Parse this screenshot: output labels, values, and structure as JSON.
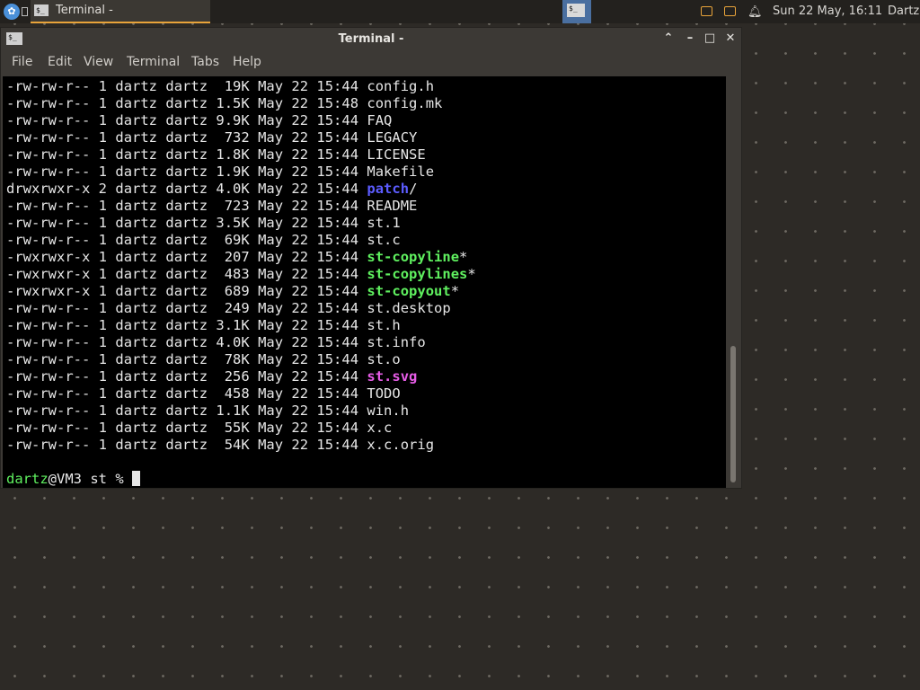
{
  "panel": {
    "task_label": "Terminal -",
    "clock": "Sun 22 May, 16:11",
    "user": "Dartz"
  },
  "window": {
    "title": "Terminal -",
    "menu": [
      "File",
      "Edit",
      "View",
      "Terminal",
      "Tabs",
      "Help"
    ]
  },
  "listing": [
    {
      "perms": "-rw-rw-r--",
      "links": "1",
      "owner": "dartz",
      "group": "dartz",
      "size": " 19K",
      "date": "May 22 15:44",
      "name": "config.h",
      "suffix": "",
      "kind": "file"
    },
    {
      "perms": "-rw-rw-r--",
      "links": "1",
      "owner": "dartz",
      "group": "dartz",
      "size": "1.5K",
      "date": "May 22 15:48",
      "name": "config.mk",
      "suffix": "",
      "kind": "file"
    },
    {
      "perms": "-rw-rw-r--",
      "links": "1",
      "owner": "dartz",
      "group": "dartz",
      "size": "9.9K",
      "date": "May 22 15:44",
      "name": "FAQ",
      "suffix": "",
      "kind": "file"
    },
    {
      "perms": "-rw-rw-r--",
      "links": "1",
      "owner": "dartz",
      "group": "dartz",
      "size": " 732",
      "date": "May 22 15:44",
      "name": "LEGACY",
      "suffix": "",
      "kind": "file"
    },
    {
      "perms": "-rw-rw-r--",
      "links": "1",
      "owner": "dartz",
      "group": "dartz",
      "size": "1.8K",
      "date": "May 22 15:44",
      "name": "LICENSE",
      "suffix": "",
      "kind": "file"
    },
    {
      "perms": "-rw-rw-r--",
      "links": "1",
      "owner": "dartz",
      "group": "dartz",
      "size": "1.9K",
      "date": "May 22 15:44",
      "name": "Makefile",
      "suffix": "",
      "kind": "file"
    },
    {
      "perms": "drwxrwxr-x",
      "links": "2",
      "owner": "dartz",
      "group": "dartz",
      "size": "4.0K",
      "date": "May 22 15:44",
      "name": "patch",
      "suffix": "/",
      "kind": "dir"
    },
    {
      "perms": "-rw-rw-r--",
      "links": "1",
      "owner": "dartz",
      "group": "dartz",
      "size": " 723",
      "date": "May 22 15:44",
      "name": "README",
      "suffix": "",
      "kind": "file"
    },
    {
      "perms": "-rw-rw-r--",
      "links": "1",
      "owner": "dartz",
      "group": "dartz",
      "size": "3.5K",
      "date": "May 22 15:44",
      "name": "st.1",
      "suffix": "",
      "kind": "file"
    },
    {
      "perms": "-rw-rw-r--",
      "links": "1",
      "owner": "dartz",
      "group": "dartz",
      "size": " 69K",
      "date": "May 22 15:44",
      "name": "st.c",
      "suffix": "",
      "kind": "file"
    },
    {
      "perms": "-rwxrwxr-x",
      "links": "1",
      "owner": "dartz",
      "group": "dartz",
      "size": " 207",
      "date": "May 22 15:44",
      "name": "st-copyline",
      "suffix": "*",
      "kind": "exe"
    },
    {
      "perms": "-rwxrwxr-x",
      "links": "1",
      "owner": "dartz",
      "group": "dartz",
      "size": " 483",
      "date": "May 22 15:44",
      "name": "st-copylines",
      "suffix": "*",
      "kind": "exe"
    },
    {
      "perms": "-rwxrwxr-x",
      "links": "1",
      "owner": "dartz",
      "group": "dartz",
      "size": " 689",
      "date": "May 22 15:44",
      "name": "st-copyout",
      "suffix": "*",
      "kind": "exe"
    },
    {
      "perms": "-rw-rw-r--",
      "links": "1",
      "owner": "dartz",
      "group": "dartz",
      "size": " 249",
      "date": "May 22 15:44",
      "name": "st.desktop",
      "suffix": "",
      "kind": "file"
    },
    {
      "perms": "-rw-rw-r--",
      "links": "1",
      "owner": "dartz",
      "group": "dartz",
      "size": "3.1K",
      "date": "May 22 15:44",
      "name": "st.h",
      "suffix": "",
      "kind": "file"
    },
    {
      "perms": "-rw-rw-r--",
      "links": "1",
      "owner": "dartz",
      "group": "dartz",
      "size": "4.0K",
      "date": "May 22 15:44",
      "name": "st.info",
      "suffix": "",
      "kind": "file"
    },
    {
      "perms": "-rw-rw-r--",
      "links": "1",
      "owner": "dartz",
      "group": "dartz",
      "size": " 78K",
      "date": "May 22 15:44",
      "name": "st.o",
      "suffix": "",
      "kind": "file"
    },
    {
      "perms": "-rw-rw-r--",
      "links": "1",
      "owner": "dartz",
      "group": "dartz",
      "size": " 256",
      "date": "May 22 15:44",
      "name": "st.svg",
      "suffix": "",
      "kind": "img"
    },
    {
      "perms": "-rw-rw-r--",
      "links": "1",
      "owner": "dartz",
      "group": "dartz",
      "size": " 458",
      "date": "May 22 15:44",
      "name": "TODO",
      "suffix": "",
      "kind": "file"
    },
    {
      "perms": "-rw-rw-r--",
      "links": "1",
      "owner": "dartz",
      "group": "dartz",
      "size": "1.1K",
      "date": "May 22 15:44",
      "name": "win.h",
      "suffix": "",
      "kind": "file"
    },
    {
      "perms": "-rw-rw-r--",
      "links": "1",
      "owner": "dartz",
      "group": "dartz",
      "size": " 55K",
      "date": "May 22 15:44",
      "name": "x.c",
      "suffix": "",
      "kind": "file"
    },
    {
      "perms": "-rw-rw-r--",
      "links": "1",
      "owner": "dartz",
      "group": "dartz",
      "size": " 54K",
      "date": "May 22 15:44",
      "name": "x.c.orig",
      "suffix": "",
      "kind": "file"
    }
  ],
  "prompt": {
    "user": "dartz",
    "host_path": "@VM3 st % "
  },
  "colors": {
    "directory": "#5c5cff",
    "executable": "#5ff05f",
    "image": "#e65ce6",
    "panel_accent": "#e8a33a"
  },
  "icons": [
    "distro-menu-icon",
    "terminal-icon",
    "notification-icon",
    "bell-icon"
  ]
}
